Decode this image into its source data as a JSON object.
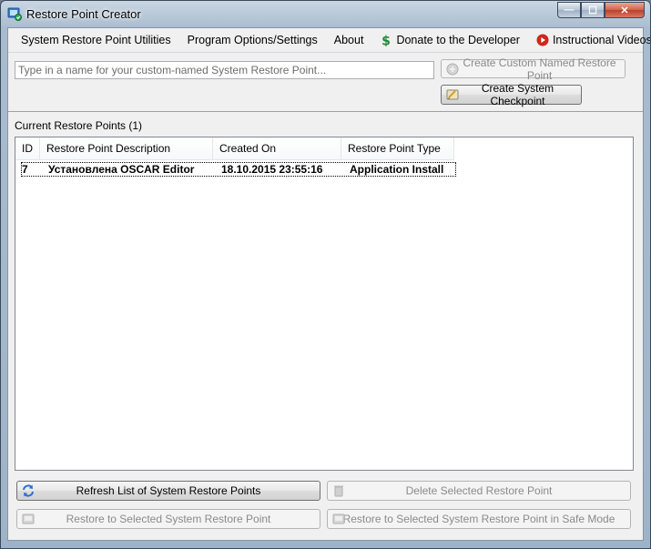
{
  "window": {
    "title": "Restore Point Creator",
    "controls": {
      "minimize": "—",
      "maximize": "☐",
      "close": "✕"
    }
  },
  "menu": {
    "items": [
      {
        "label": "System Restore Point Utilities"
      },
      {
        "label": "Program Options/Settings"
      },
      {
        "label": "About"
      },
      {
        "label": "Donate to the Developer",
        "icon": "dollar-icon"
      },
      {
        "label": "Instructional Videos",
        "icon": "play-icon"
      }
    ]
  },
  "create": {
    "placeholder": "Type in a name for your custom-named System Restore Point...",
    "value": "",
    "custom_button": "Create Custom Named Restore Point",
    "checkpoint_button": "Create System Checkpoint"
  },
  "list": {
    "label": "Current Restore Points (1)",
    "columns": [
      "ID",
      "Restore Point Description",
      "Created On",
      "Restore Point Type"
    ],
    "rows": [
      {
        "id": "7",
        "description": "Установлена OSCAR Editor",
        "created": "18.10.2015 23:55:16",
        "type": "Application Install"
      }
    ]
  },
  "actions": {
    "refresh": "Refresh List of System Restore Points",
    "delete": "Delete Selected Restore Point",
    "restore": "Restore to Selected System Restore Point",
    "restore_safe": "Restore to Selected System Restore Point in Safe Mode"
  },
  "colors": {
    "donate_icon": "#1e8a3a",
    "video_icon": "#d0261c",
    "disabled_text": "#8a8a8a"
  }
}
